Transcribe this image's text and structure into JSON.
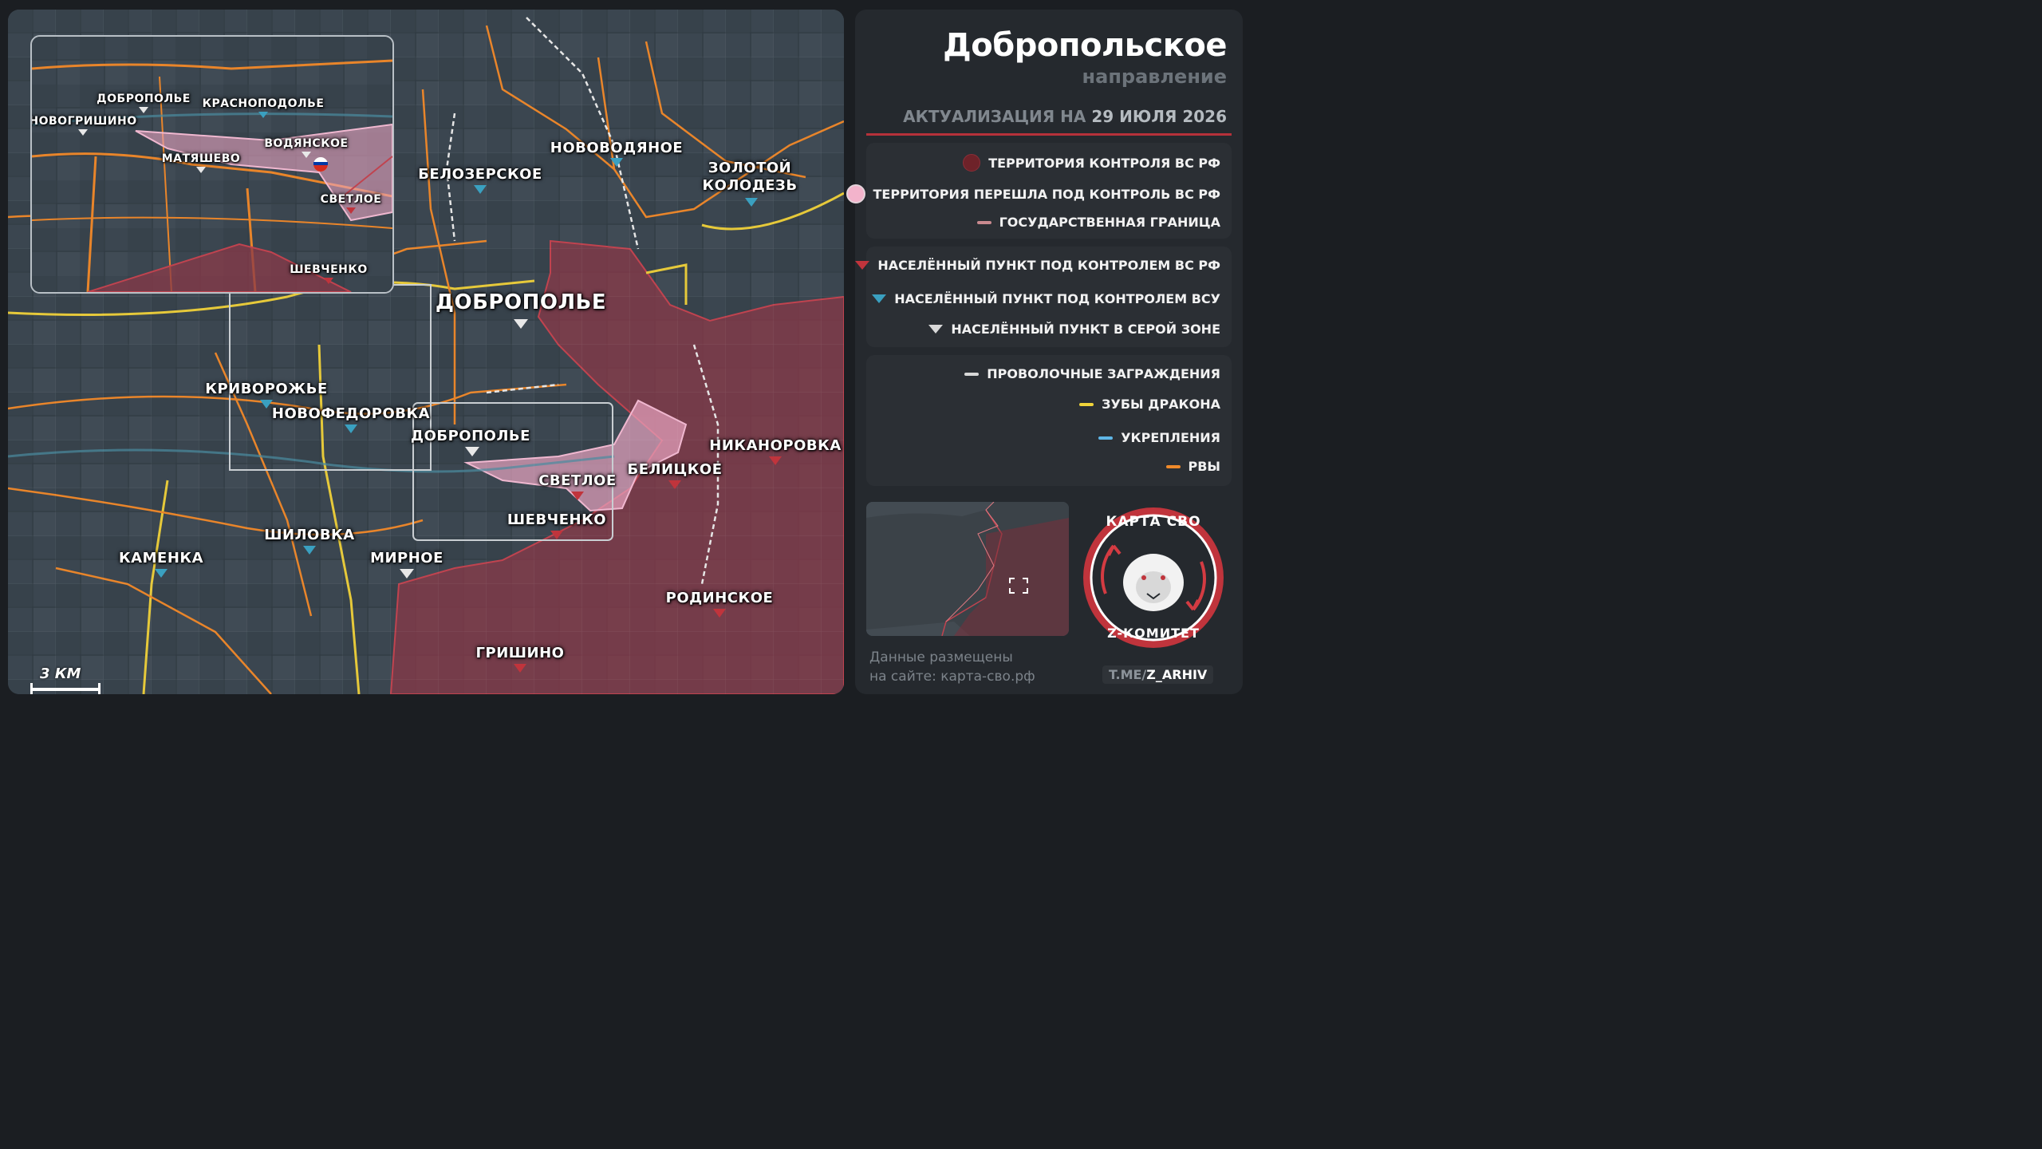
{
  "header": {
    "title": "Добропольское",
    "subtitle": "направление",
    "update_prefix": "АКТУАЛИЗАЦИЯ НА",
    "update_date": "29 ИЮЛЯ 2026"
  },
  "legend": {
    "territory": [
      {
        "label": "ТЕРРИТОРИЯ КОНТРОЛЯ ВС РФ",
        "color": "#6e2229",
        "icon": "territory-dot-icon"
      },
      {
        "label": "ТЕРРИТОРИЯ ПЕРЕШЛА ПОД КОНТРОЛЬ ВС РФ",
        "color": "#f3b3cb",
        "icon": "territory-new-dot-icon"
      },
      {
        "label": "ГОСУДАРСТВЕННАЯ ГРАНИЦА",
        "color": "#c98a8f",
        "icon": "border-line-icon"
      }
    ],
    "settlements": [
      {
        "label": "НАСЕЛЁННЫЙ ПУНКТ ПОД КОНТРОЛЕМ ВС РФ",
        "color": "#c0343c"
      },
      {
        "label": "НАСЕЛЁННЫЙ ПУНКТ ПОД КОНТРОЛЕМ ВСУ",
        "color": "#3aa0c0"
      },
      {
        "label": "НАСЕЛЁННЫЙ ПУНКТ В СЕРОЙ ЗОНЕ",
        "color": "#d9d9d9"
      }
    ],
    "fortifications": [
      {
        "label": "ПРОВОЛОЧНЫЕ ЗАГРАЖДЕНИЯ",
        "color": "#d8d8d8"
      },
      {
        "label": "ЗУБЫ ДРАКОНА",
        "color": "#f0d43a"
      },
      {
        "label": "УКРЕПЛЕНИЯ",
        "color": "#5fb6e6"
      },
      {
        "label": "РВЫ",
        "color": "#f08a2a"
      }
    ]
  },
  "footer": {
    "info_line1": "Данные размещены",
    "info_line2": "на сайте: карта-сво.рф",
    "channel_prefix": "T.ME/",
    "channel_name": "Z_ARHIV",
    "emblem_top": "КАРТА СВО",
    "emblem_bottom": "Z-КОМИТЕТ"
  },
  "map": {
    "scale_label": "3 КМ",
    "settlements": [
      {
        "name": "ДОБРОПОЛЬЕ",
        "status": "grey",
        "size": "city"
      },
      {
        "name": "БЕЛОЗЕРСКОЕ",
        "status": "blue"
      },
      {
        "name": "НОВОВОДЯНОЕ",
        "status": "blue"
      },
      {
        "name": "ЗОЛОТОЙ",
        "status": "blue"
      },
      {
        "name": "КОЛОДЕЗЬ",
        "status": "blue"
      },
      {
        "name": "КРИВОРОЖЬЕ",
        "status": "blue"
      },
      {
        "name": "НОВОФЕДОРОВКА",
        "status": "blue"
      },
      {
        "name": "ДОБРОПОЛЬЕ",
        "status": "grey"
      },
      {
        "name": "СВЕТЛОЕ",
        "status": "red"
      },
      {
        "name": "БЕЛИЦКОЕ",
        "status": "red"
      },
      {
        "name": "НИКАНОРОВКА",
        "status": "red"
      },
      {
        "name": "ШЕВЧЕНКО",
        "status": "red"
      },
      {
        "name": "ШИЛОВКА",
        "status": "blue"
      },
      {
        "name": "КАМЕНКА",
        "status": "blue"
      },
      {
        "name": "МИРНОЕ",
        "status": "grey"
      },
      {
        "name": "РОДИНСКОЕ",
        "status": "red"
      },
      {
        "name": "ГРИШИНО",
        "status": "red"
      }
    ],
    "inset": [
      {
        "name": "ДОБРОПОЛЬЕ",
        "status": "grey"
      },
      {
        "name": "КРАСНОПОДОЛЬЕ",
        "status": "blue"
      },
      {
        "name": "НОВОГРИШИНО",
        "status": "grey"
      },
      {
        "name": "ВОДЯНСКОЕ",
        "status": "grey"
      },
      {
        "name": "МАТЯШЕВО",
        "status": "grey"
      },
      {
        "name": "СВЕТЛОЕ",
        "status": "red"
      },
      {
        "name": "ШЕВЧЕНКО",
        "status": "red"
      }
    ]
  }
}
